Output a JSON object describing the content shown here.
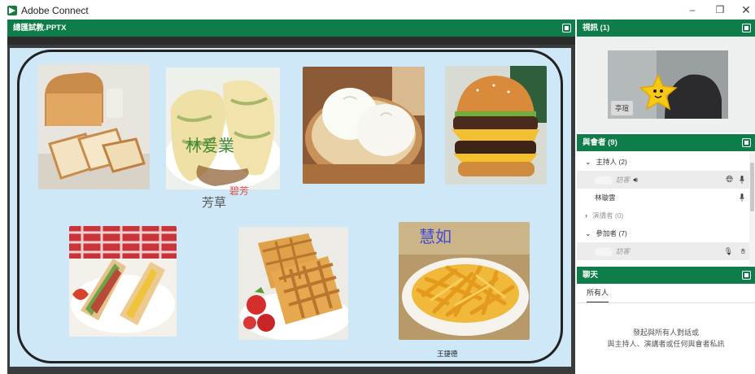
{
  "window": {
    "title": "Adobe Connect",
    "min": "–",
    "max": "❐",
    "close": "✕"
  },
  "share": {
    "title": "總匯試教.PPTX",
    "annotations": {
      "name1": "林爰業",
      "name2": "芳草",
      "name3": "碧芳",
      "name4": "慧如",
      "name5": "王捷德"
    },
    "foods": [
      "toast",
      "egg-pancake-roll",
      "steamed-buns",
      "burger",
      "sandwich",
      "waffle",
      "fries"
    ]
  },
  "video": {
    "title": "視訊 (1)",
    "name": "亭瑄"
  },
  "attendees": {
    "title": "與會者 (9)",
    "hosts_group": "主持人 (2)",
    "host1": "訪客",
    "host2": "林璇雲",
    "presenters_group": "演講者 (0)",
    "participants_group": "參加者 (7)",
    "participant1": "訪客"
  },
  "chat": {
    "title": "聊天",
    "tab": "所有人",
    "hint_line1": "發起與所有人對話或",
    "hint_line2": "與主持人、演講者或任何與會者私訊"
  },
  "colors": {
    "pod_green": "#0f7d49",
    "slide_bg": "#cfe8f7"
  }
}
